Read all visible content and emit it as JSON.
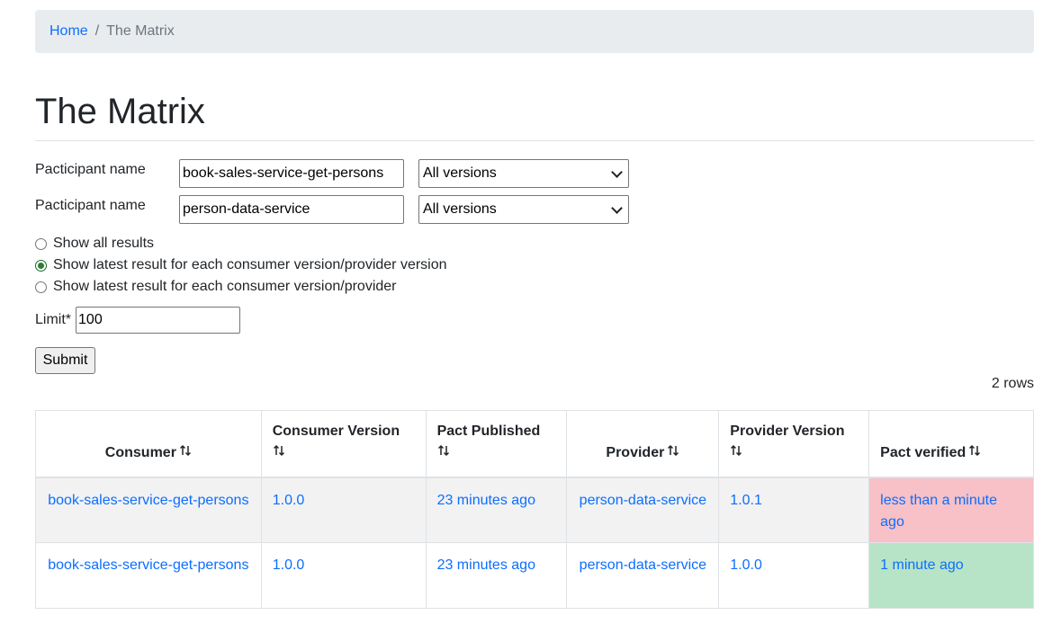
{
  "breadcrumb": {
    "home": "Home",
    "separator": "/",
    "current": "The Matrix"
  },
  "page_title": "The Matrix",
  "filters": [
    {
      "label": "Pacticipant name",
      "name_value": "book-sales-service-get-persons",
      "version_selected": "All versions"
    },
    {
      "label": "Pacticipant name",
      "name_value": "person-data-service",
      "version_selected": "All versions"
    }
  ],
  "radios": [
    {
      "label": "Show all results",
      "checked": false
    },
    {
      "label": "Show latest result for each consumer version/provider version",
      "checked": true
    },
    {
      "label": "Show latest result for each consumer version/provider",
      "checked": false
    }
  ],
  "limit": {
    "label": "Limit*",
    "value": "100"
  },
  "submit_label": "Submit",
  "row_count": "2 rows",
  "table": {
    "headers": [
      {
        "label": "Consumer",
        "sortable": true,
        "align": "center"
      },
      {
        "label": "Consumer Version",
        "sortable": true,
        "align": "left"
      },
      {
        "label": "Pact Published",
        "sortable": true,
        "align": "left"
      },
      {
        "label": "Provider",
        "sortable": true,
        "align": "center"
      },
      {
        "label": "Provider Version",
        "sortable": true,
        "align": "left"
      },
      {
        "label": "Pact verified",
        "sortable": true,
        "align": "left"
      }
    ],
    "rows": [
      {
        "consumer": "book-sales-service-get-persons",
        "consumer_version": "1.0.0",
        "pact_published": "23 minutes ago",
        "provider": "person-data-service",
        "provider_version": "1.0.1",
        "pact_verified": "less than a minute ago",
        "verified_status": "failed"
      },
      {
        "consumer": "book-sales-service-get-persons",
        "consumer_version": "1.0.0",
        "pact_published": "23 minutes ago",
        "provider": "person-data-service",
        "provider_version": "1.0.0",
        "pact_verified": "1 minute ago",
        "verified_status": "success"
      }
    ]
  },
  "colors": {
    "link": "#0d6efd",
    "verified_failed_bg": "#f8c0c7",
    "verified_success_bg": "#b7e4c7",
    "breadcrumb_bg": "#e9ecef",
    "striped_row_bg": "#f2f2f2"
  }
}
